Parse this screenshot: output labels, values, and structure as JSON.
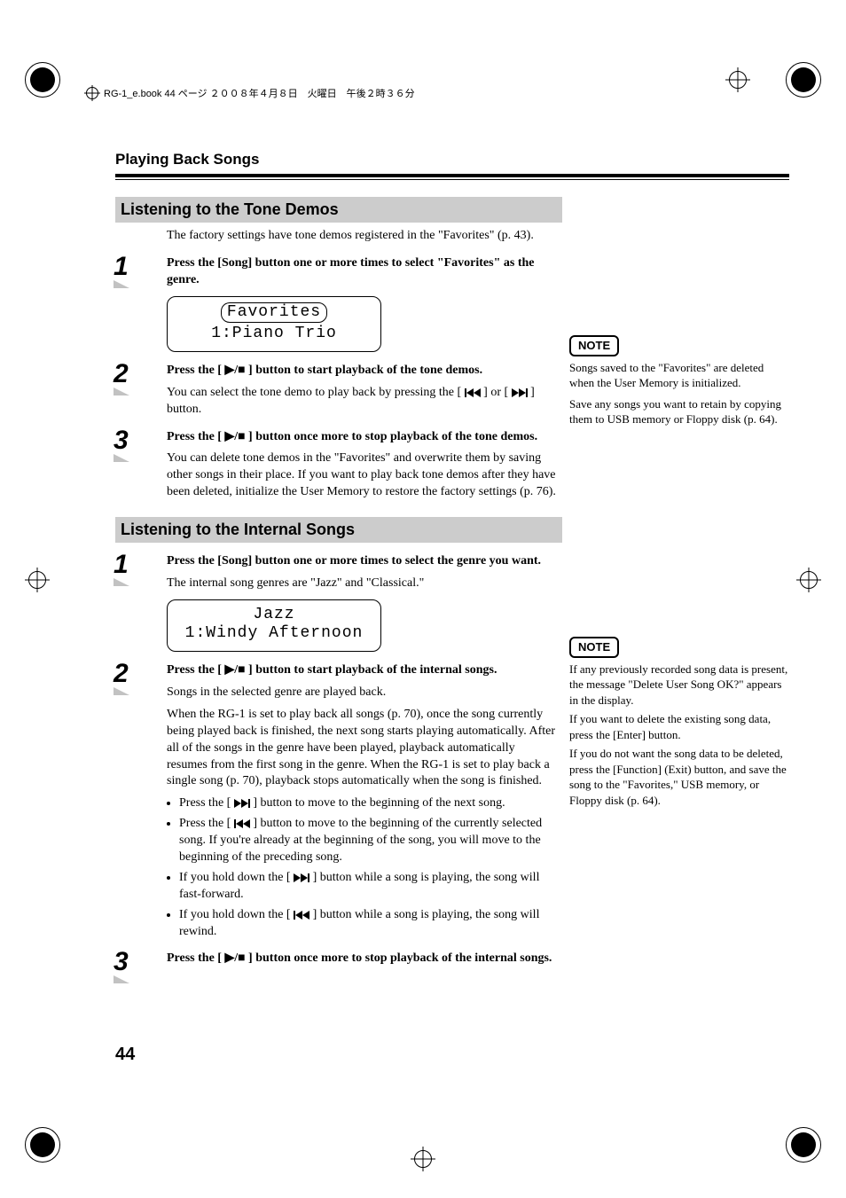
{
  "header_line": "RG-1_e.book 44 ページ ２００８年４月８日　火曜日　午後２時３６分",
  "chapter_title": "Playing Back Songs",
  "page_number": "44",
  "section1": {
    "title": "Listening to the Tone Demos",
    "intro": "The factory settings have tone demos registered in the \"Favorites\" (p. 43).",
    "step1": "Press the [Song] button one or more times to select \"Favorites\" as the genre.",
    "lcd_top": "Favorites",
    "lcd_bottom": "1:Piano Trio",
    "step2": "Press the [ ▶/■ ] button to start playback of the tone demos.",
    "step2_body_a": "You can select the tone demo to play back by pressing the [ ",
    "step2_body_b": " ] or [ ",
    "step2_body_c": " ] button.",
    "step3": "Press the [ ▶/■ ] button once more to stop playback of the tone demos.",
    "step3_body": "You can delete tone demos in the \"Favorites\" and overwrite them by saving other songs in their place. If you want to play back tone demos after they have been deleted, initialize the User Memory to restore the factory settings (p. 76)."
  },
  "note1_label": "NOTE",
  "note1_p1": "Songs saved to the \"Favorites\" are deleted when the User Memory is initialized.",
  "note1_p2": "Save any songs you want to retain by copying them to USB memory or Floppy disk (p. 64).",
  "section2": {
    "title": "Listening to the Internal Songs",
    "step1": "Press the [Song] button one or more times to select the genre you want.",
    "step1_body": "The internal song genres are \"Jazz\" and \"Classical.\"",
    "lcd_top": "Jazz",
    "lcd_bottom": "1:Windy Afternoon",
    "step2": "Press the [ ▶/■ ] button to start playback of the internal songs.",
    "step2_p1": "Songs in the selected genre are played back.",
    "step2_p2": "When the RG-1 is set to play back all songs (p. 70), once the song currently being played back is finished, the next song starts playing automatically. After all of the songs in the genre have been played, playback automatically resumes from the first song in the genre. When the RG-1 is set to play back a single song (p. 70), playback stops automatically when the song is finished.",
    "b1a": "Press the [ ",
    "b1b": " ] button to move to the beginning of the next song.",
    "b2a": "Press the [ ",
    "b2b": " ] button to move to the beginning of the currently selected song. If you're already at the beginning of the song, you will move to the beginning of the preceding song.",
    "b3a": "If you hold down the [ ",
    "b3b": " ] button while a song is playing, the song will fast-forward.",
    "b4a": "If you hold down the [ ",
    "b4b": " ] button while a song is playing, the song will rewind.",
    "step3": "Press the [ ▶/■ ] button once more to stop playback of the internal songs."
  },
  "note2_label": "NOTE",
  "note2_p1": "If any previously recorded song data is present, the message \"Delete User Song OK?\" appears in the display.",
  "note2_p2": "If you want to delete the existing song data, press the [Enter] button.",
  "note2_p3": "If you do not want the song data to be deleted, press the [Function] (Exit) button, and save the song to the \"Favorites,\" USB memory, or Floppy disk (p. 64)."
}
